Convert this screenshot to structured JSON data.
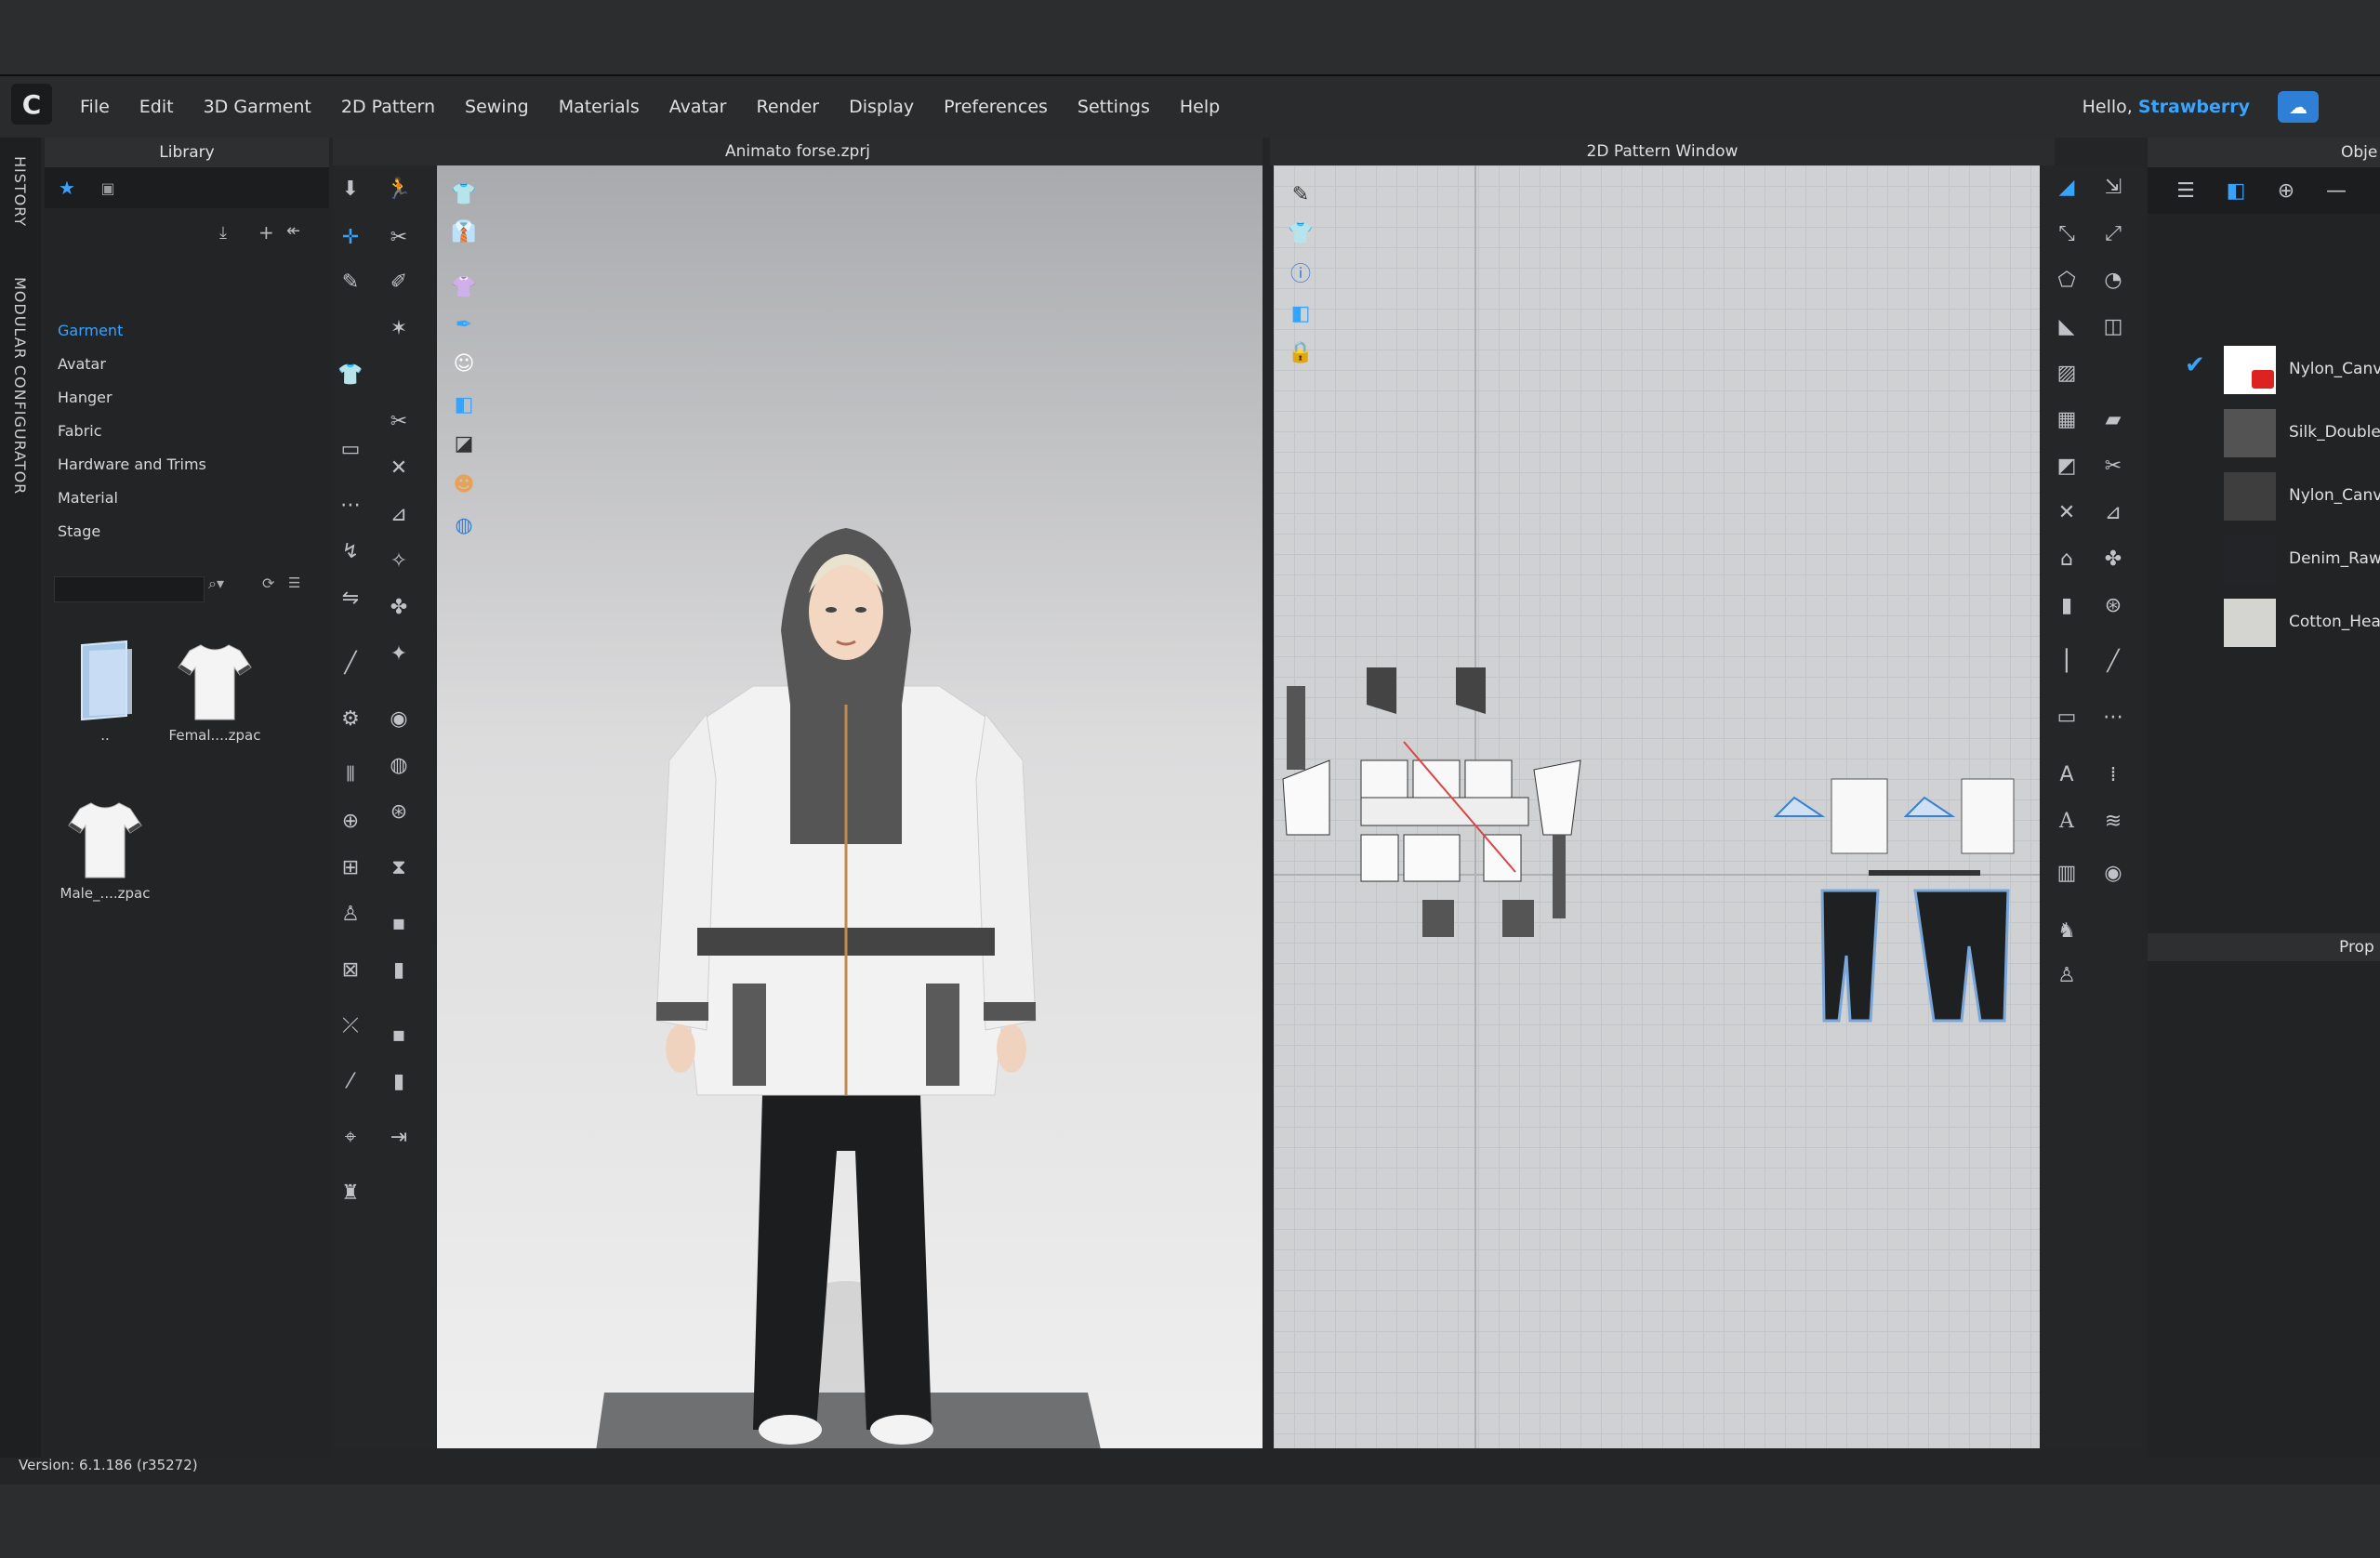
{
  "menu": {
    "logo": "C",
    "items": [
      "File",
      "Edit",
      "3D Garment",
      "2D Pattern",
      "Sewing",
      "Materials",
      "Avatar",
      "Render",
      "Display",
      "Preferences",
      "Settings",
      "Help"
    ],
    "hello_prefix": "Hello,",
    "user": "Strawberry"
  },
  "side_tabs": {
    "history": "HISTORY",
    "modular": "MODULAR CONFIGURATOR"
  },
  "library": {
    "title": "Library",
    "categories": [
      "Garment",
      "Avatar",
      "Hanger",
      "Fabric",
      "Hardware and Trims",
      "Material",
      "Stage"
    ],
    "active_category": "Garment",
    "files": [
      {
        "label": ".."
      },
      {
        "label": "Femal....zpac"
      },
      {
        "label": "Male_....zpac"
      }
    ]
  },
  "viewport3d": {
    "title": "Animato forse.zprj"
  },
  "pattern2d": {
    "title": "2D Pattern Window"
  },
  "object_browser": {
    "title": "Obje",
    "materials": [
      {
        "name": "Nylon_Canva",
        "color": "#ffffff",
        "checked": true
      },
      {
        "name": "Silk_Double_",
        "color": "#535353",
        "checked": false
      },
      {
        "name": "Nylon_Canva",
        "color": "#3e3e3e",
        "checked": false
      },
      {
        "name": "Denim_Raw",
        "color": "#232427",
        "checked": false
      },
      {
        "name": "Cotton_Hea",
        "color": "#d4d4d0",
        "checked": false
      }
    ]
  },
  "property_editor": {
    "title": "Prop"
  },
  "status": {
    "version": "Version: 6.1.186 (r35272)"
  },
  "colors": {
    "accent": "#36a4ff",
    "cloud": "#2f7fd6"
  }
}
